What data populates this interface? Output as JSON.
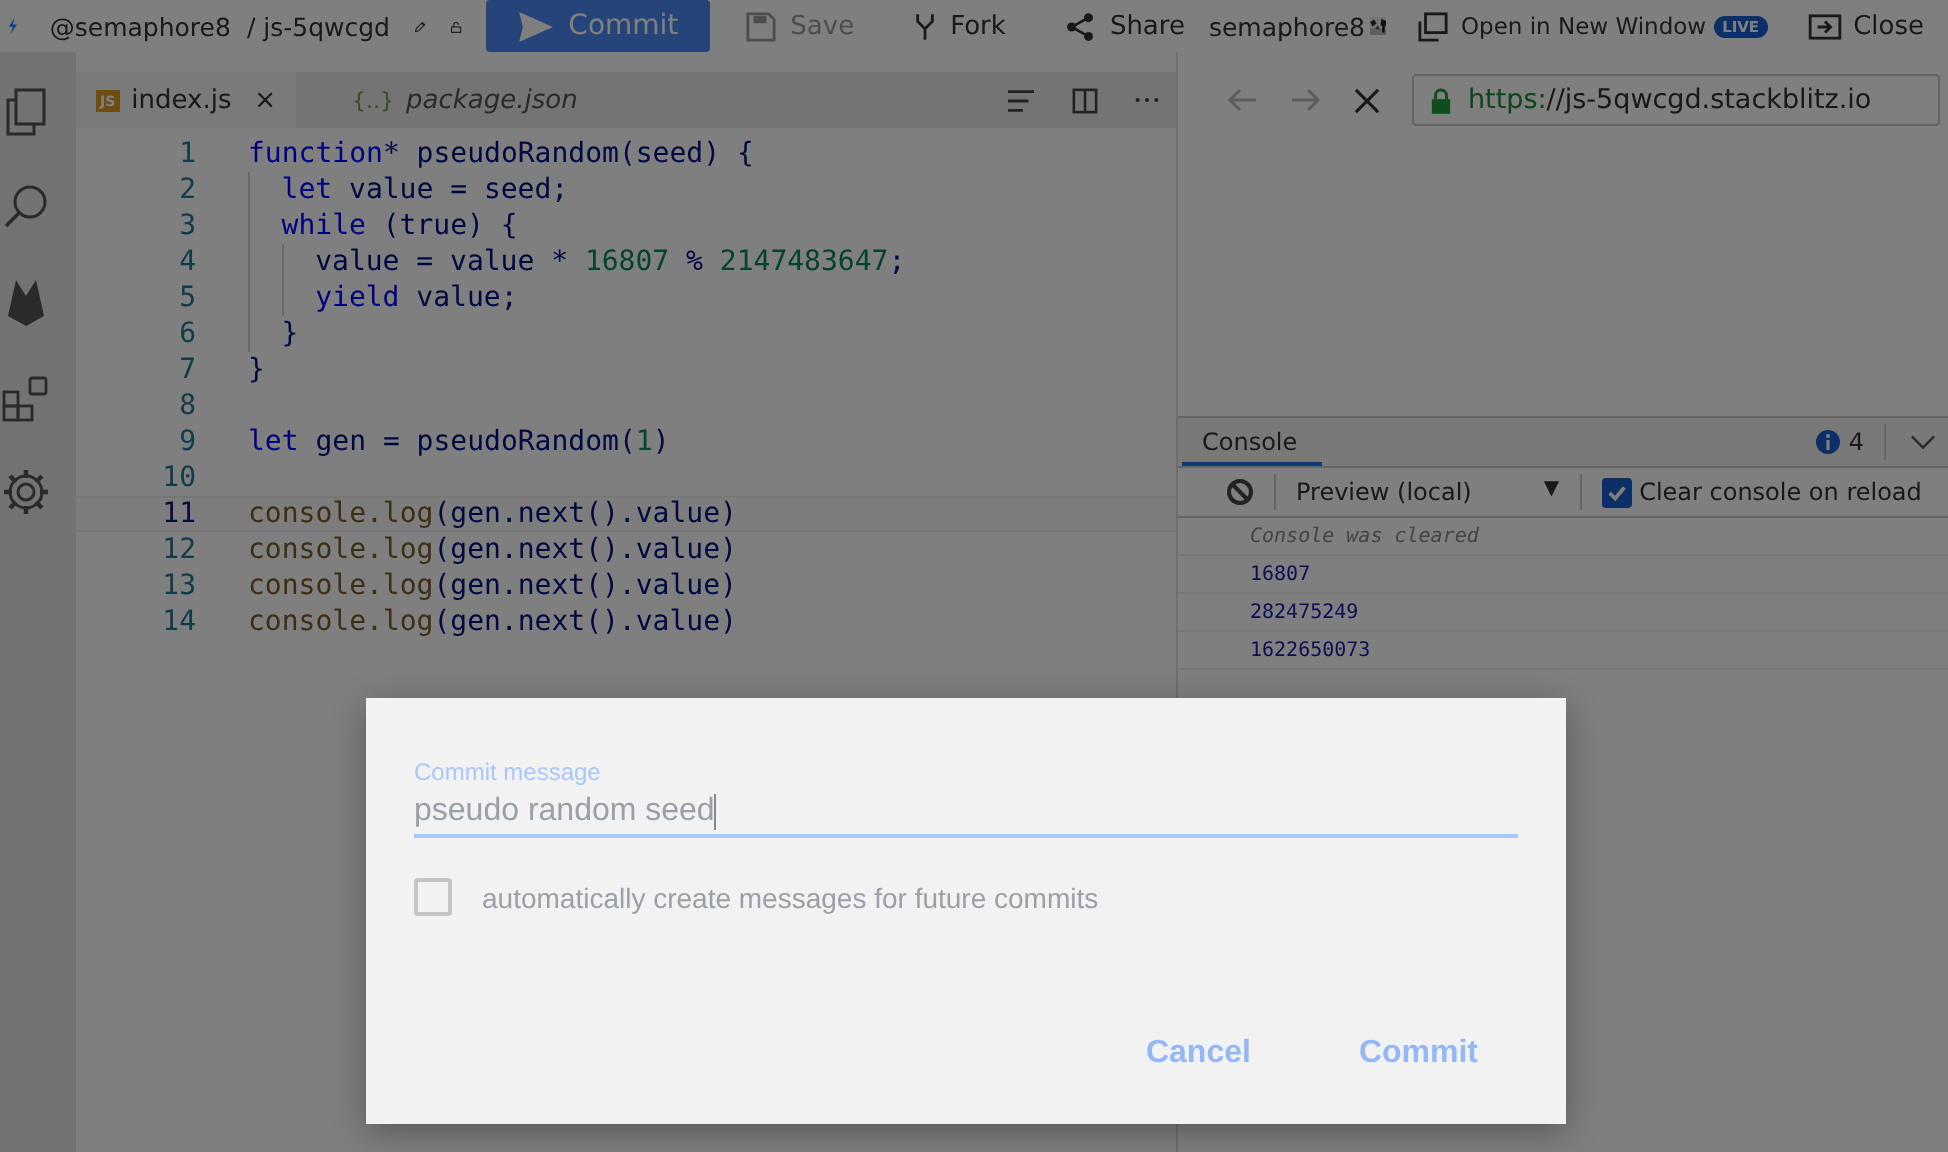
{
  "topbar": {
    "user": "@semaphore8",
    "project": "/ js-5qwcgd",
    "buttons": [
      {
        "kind": "primary",
        "label": "Commit",
        "disabled": false
      },
      {
        "kind": "save",
        "label": "Save",
        "disabled": true
      },
      {
        "kind": "fork",
        "label": "Fork",
        "disabled": false
      },
      {
        "kind": "share",
        "label": "Share",
        "disabled": false
      }
    ],
    "account": "semaphore8",
    "open_window": "Open in New Window",
    "live_badge": "LIVE",
    "close": "Close"
  },
  "tabs": [
    {
      "icon": "JS",
      "label": "index.js",
      "selected": true,
      "close": "×"
    },
    {
      "icon": "{..}",
      "label": "package.json",
      "selected": false
    }
  ],
  "editor": {
    "lines": [
      {
        "number": "1",
        "current": false,
        "tokens": [
          {
            "kind": "kw",
            "text": "function"
          },
          {
            "kind": "plain",
            "text": "* pseudoRandom(seed) {"
          }
        ],
        "children": [
          {
            "number": "2",
            "current": false,
            "tokens": [
              {
                "kind": "kw",
                "text": "let"
              },
              {
                "kind": "plain",
                "text": " value = seed;"
              }
            ]
          },
          {
            "number": "3",
            "current": false,
            "tokens": [
              {
                "kind": "kw",
                "text": "while"
              },
              {
                "kind": "plain",
                "text": " (true) {"
              }
            ],
            "children": [
              {
                "number": "4",
                "current": false,
                "tokens": [
                  {
                    "kind": "plain",
                    "text": "value = value * "
                  },
                  {
                    "kind": "num",
                    "text": "16807"
                  },
                  {
                    "kind": "plain",
                    "text": " % "
                  },
                  {
                    "kind": "num",
                    "text": "2147483647"
                  },
                  {
                    "kind": "plain",
                    "text": ";"
                  }
                ]
              },
              {
                "number": "5",
                "current": false,
                "tokens": [
                  {
                    "kind": "kw",
                    "text": "yield"
                  },
                  {
                    "kind": "plain",
                    "text": " value;"
                  }
                ]
              }
            ]
          },
          {
            "number": "6",
            "current": false,
            "tokens": [
              {
                "kind": "plain",
                "text": "}"
              }
            ]
          }
        ]
      },
      {
        "number": "7",
        "current": false,
        "tokens": [
          {
            "kind": "plain",
            "text": "}"
          }
        ]
      },
      {
        "number": "8",
        "current": false
      },
      {
        "number": "9",
        "current": false,
        "tokens": [
          {
            "kind": "kw",
            "text": "let"
          },
          {
            "kind": "plain",
            "text": " gen = pseudoRandom("
          },
          {
            "kind": "num",
            "text": "1"
          },
          {
            "kind": "plain",
            "text": ")"
          }
        ]
      },
      {
        "number": "10",
        "current": false
      },
      {
        "number": "11",
        "current": true,
        "tokens": [
          {
            "kind": "fn",
            "text": "console.log"
          },
          {
            "kind": "plain",
            "text": "(gen.next().value)"
          }
        ]
      },
      {
        "number": "12",
        "current": false,
        "tokens": [
          {
            "kind": "fn",
            "text": "console.log"
          },
          {
            "kind": "plain",
            "text": "(gen.next().value)"
          }
        ]
      },
      {
        "number": "13",
        "current": false,
        "tokens": [
          {
            "kind": "fn",
            "text": "console.log"
          },
          {
            "kind": "plain",
            "text": "(gen.next().value)"
          }
        ]
      },
      {
        "number": "14",
        "current": false,
        "tokens": [
          {
            "kind": "fn",
            "text": "console.log"
          },
          {
            "kind": "plain",
            "text": "(gen.next().value)"
          }
        ]
      }
    ]
  },
  "browser": {
    "url_scheme": "https:",
    "url_rest": "//js-5qwcgd.stackblitz.io"
  },
  "console": {
    "tab": "Console",
    "count": "4",
    "context": "Preview (local)",
    "dropdown": "▼",
    "clear_on_reload": {
      "label": "Clear console on reload",
      "checked": true
    },
    "entries": [
      {
        "kind": "info",
        "text": "Console was cleared"
      },
      {
        "kind": "log",
        "text": "16807"
      },
      {
        "kind": "log",
        "text": "282475249"
      },
      {
        "kind": "log",
        "text": "1622650073"
      }
    ]
  },
  "dialog": {
    "field_label": "Commit message",
    "value": "pseudo random seed",
    "auto_messages": {
      "label": "automatically create messages for future commits",
      "checked": false
    },
    "buttons": [
      "Cancel",
      "Commit"
    ]
  }
}
